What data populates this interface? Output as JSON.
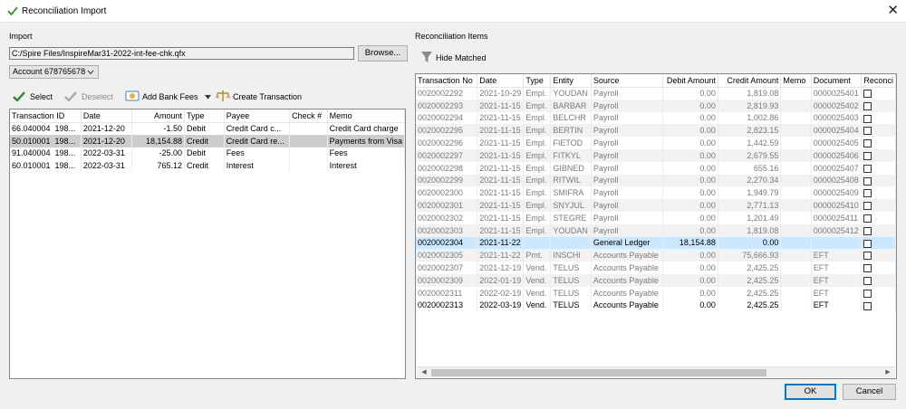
{
  "window": {
    "title": "Reconciliation Import",
    "close_label": "✕"
  },
  "import": {
    "section_label": "Import",
    "file_path": "C:/Spire Files/InspireMar31-2022-int-fee-chk.qfx",
    "browse_label": "Browse...",
    "account_selected": "Account 678765678",
    "toolbar": {
      "select_label": "Select",
      "deselect_label": "Deselect",
      "add_bank_fees_label": "Add Bank Fees",
      "create_transaction_label": "Create Transaction"
    },
    "columns": [
      "Transaction ID",
      "Date",
      "Amount",
      "Type",
      "Payee",
      "Check #",
      "Memo"
    ],
    "rows": [
      [
        "66.040004",
        "198...",
        "2021-12-20",
        "-1.50",
        "Debit",
        "Credit Card c...",
        "",
        "Credit Card charge"
      ],
      [
        "50.010001",
        "198...",
        "2021-12-20",
        "18,154.88",
        "Credit",
        "Credit Card re...",
        "",
        "Payments from Visa"
      ],
      [
        "91.040004",
        "198...",
        "2022-03-31",
        "-25.00",
        "Debit",
        "Fees",
        "",
        "Fees"
      ],
      [
        "60.010001",
        "198...",
        "2022-03-31",
        "765.12",
        "Credit",
        "Interest",
        "",
        "Interest"
      ]
    ],
    "selected_row": 1
  },
  "items": {
    "section_label": "Reconciliation Items",
    "hide_matched_label": "Hide Matched",
    "columns": [
      "Transaction No",
      "Date",
      "Type",
      "Entity",
      "Source",
      "Debit Amount",
      "Credit Amount",
      "Memo",
      "Document",
      "Reconci"
    ],
    "rows": [
      [
        "0020002292",
        "2021-10-29",
        "Empl.",
        "YOUDAN",
        "Payroll",
        "0.00",
        "1,819.08",
        "",
        "0000025401"
      ],
      [
        "0020002293",
        "2021-11-15",
        "Empl.",
        "BARBAR",
        "Payroll",
        "0.00",
        "2,819.93",
        "",
        "0000025402"
      ],
      [
        "0020002294",
        "2021-11-15",
        "Empl.",
        "BELCHR",
        "Payroll",
        "0.00",
        "1,002.86",
        "",
        "0000025403"
      ],
      [
        "0020002295",
        "2021-11-15",
        "Empl.",
        "BERTIN",
        "Payroll",
        "0.00",
        "2,823.15",
        "",
        "0000025404"
      ],
      [
        "0020002296",
        "2021-11-15",
        "Empl.",
        "FIETOD",
        "Payroll",
        "0.00",
        "1,442.59",
        "",
        "0000025405"
      ],
      [
        "0020002297",
        "2021-11-15",
        "Empl.",
        "FITKYL",
        "Payroll",
        "0.00",
        "2,679.55",
        "",
        "0000025406"
      ],
      [
        "0020002298",
        "2021-11-15",
        "Empl.",
        "GIBNED",
        "Payroll",
        "0.00",
        "655.16",
        "",
        "0000025407"
      ],
      [
        "0020002299",
        "2021-11-15",
        "Empl.",
        "RITWIL",
        "Payroll",
        "0.00",
        "2,270.34",
        "",
        "0000025408"
      ],
      [
        "0020002300",
        "2021-11-15",
        "Empl.",
        "SMIFRA",
        "Payroll",
        "0.00",
        "1,949.79",
        "",
        "0000025409"
      ],
      [
        "0020002301",
        "2021-11-15",
        "Empl.",
        "SNYJUL",
        "Payroll",
        "0.00",
        "2,771.13",
        "",
        "0000025410"
      ],
      [
        "0020002302",
        "2021-11-15",
        "Empl.",
        "STEGRE",
        "Payroll",
        "0.00",
        "1,201.49",
        "",
        "0000025411"
      ],
      [
        "0020002303",
        "2021-11-15",
        "Empl.",
        "YOUDAN",
        "Payroll",
        "0.00",
        "1,819.08",
        "",
        "0000025412"
      ],
      [
        "0020002304",
        "2021-11-22",
        "",
        "",
        "General Ledger",
        "18,154.88",
        "0.00",
        "",
        ""
      ],
      [
        "0020002305",
        "2021-11-22",
        "Pmt.",
        "INSCHI",
        "Accounts Payable",
        "0.00",
        "75,666.93",
        "",
        "EFT"
      ],
      [
        "0020002307",
        "2021-12-19",
        "Vend.",
        "TELUS",
        "Accounts Payable",
        "0.00",
        "2,425.25",
        "",
        "EFT"
      ],
      [
        "0020002309",
        "2022-01-19",
        "Vend.",
        "TELUS",
        "Accounts Payable",
        "0.00",
        "2,425.25",
        "",
        "EFT"
      ],
      [
        "0020002311",
        "2022-02-19",
        "Vend.",
        "TELUS",
        "Accounts Payable",
        "0.00",
        "2,425.25",
        "",
        "EFT"
      ],
      [
        "0020002313",
        "2022-03-19",
        "Vend.",
        "TELUS",
        "Accounts Payable",
        "0.00",
        "2,425.25",
        "",
        "EFT"
      ]
    ],
    "highlighted_row": 12,
    "bold_row": 17
  },
  "footer": {
    "ok_label": "OK",
    "cancel_label": "Cancel"
  },
  "colors": {
    "selected_row": "#cdcdcd",
    "highlighted_row": "#cce8ff",
    "accent": "#0078d7"
  },
  "icons": [
    "reconcile-check-icon",
    "select-check-icon",
    "deselect-check-icon",
    "bank-fees-icon",
    "create-transaction-icon",
    "filter-funnel-icon"
  ]
}
